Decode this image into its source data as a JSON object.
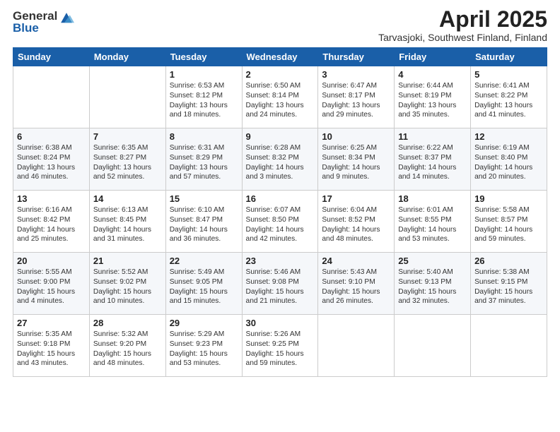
{
  "header": {
    "logo_general": "General",
    "logo_blue": "Blue",
    "month_title": "April 2025",
    "location": "Tarvasjoki, Southwest Finland, Finland"
  },
  "weekdays": [
    "Sunday",
    "Monday",
    "Tuesday",
    "Wednesday",
    "Thursday",
    "Friday",
    "Saturday"
  ],
  "weeks": [
    [
      {
        "day": "",
        "info": ""
      },
      {
        "day": "",
        "info": ""
      },
      {
        "day": "1",
        "info": "Sunrise: 6:53 AM\nSunset: 8:12 PM\nDaylight: 13 hours and 18 minutes."
      },
      {
        "day": "2",
        "info": "Sunrise: 6:50 AM\nSunset: 8:14 PM\nDaylight: 13 hours and 24 minutes."
      },
      {
        "day": "3",
        "info": "Sunrise: 6:47 AM\nSunset: 8:17 PM\nDaylight: 13 hours and 29 minutes."
      },
      {
        "day": "4",
        "info": "Sunrise: 6:44 AM\nSunset: 8:19 PM\nDaylight: 13 hours and 35 minutes."
      },
      {
        "day": "5",
        "info": "Sunrise: 6:41 AM\nSunset: 8:22 PM\nDaylight: 13 hours and 41 minutes."
      }
    ],
    [
      {
        "day": "6",
        "info": "Sunrise: 6:38 AM\nSunset: 8:24 PM\nDaylight: 13 hours and 46 minutes."
      },
      {
        "day": "7",
        "info": "Sunrise: 6:35 AM\nSunset: 8:27 PM\nDaylight: 13 hours and 52 minutes."
      },
      {
        "day": "8",
        "info": "Sunrise: 6:31 AM\nSunset: 8:29 PM\nDaylight: 13 hours and 57 minutes."
      },
      {
        "day": "9",
        "info": "Sunrise: 6:28 AM\nSunset: 8:32 PM\nDaylight: 14 hours and 3 minutes."
      },
      {
        "day": "10",
        "info": "Sunrise: 6:25 AM\nSunset: 8:34 PM\nDaylight: 14 hours and 9 minutes."
      },
      {
        "day": "11",
        "info": "Sunrise: 6:22 AM\nSunset: 8:37 PM\nDaylight: 14 hours and 14 minutes."
      },
      {
        "day": "12",
        "info": "Sunrise: 6:19 AM\nSunset: 8:40 PM\nDaylight: 14 hours and 20 minutes."
      }
    ],
    [
      {
        "day": "13",
        "info": "Sunrise: 6:16 AM\nSunset: 8:42 PM\nDaylight: 14 hours and 25 minutes."
      },
      {
        "day": "14",
        "info": "Sunrise: 6:13 AM\nSunset: 8:45 PM\nDaylight: 14 hours and 31 minutes."
      },
      {
        "day": "15",
        "info": "Sunrise: 6:10 AM\nSunset: 8:47 PM\nDaylight: 14 hours and 36 minutes."
      },
      {
        "day": "16",
        "info": "Sunrise: 6:07 AM\nSunset: 8:50 PM\nDaylight: 14 hours and 42 minutes."
      },
      {
        "day": "17",
        "info": "Sunrise: 6:04 AM\nSunset: 8:52 PM\nDaylight: 14 hours and 48 minutes."
      },
      {
        "day": "18",
        "info": "Sunrise: 6:01 AM\nSunset: 8:55 PM\nDaylight: 14 hours and 53 minutes."
      },
      {
        "day": "19",
        "info": "Sunrise: 5:58 AM\nSunset: 8:57 PM\nDaylight: 14 hours and 59 minutes."
      }
    ],
    [
      {
        "day": "20",
        "info": "Sunrise: 5:55 AM\nSunset: 9:00 PM\nDaylight: 15 hours and 4 minutes."
      },
      {
        "day": "21",
        "info": "Sunrise: 5:52 AM\nSunset: 9:02 PM\nDaylight: 15 hours and 10 minutes."
      },
      {
        "day": "22",
        "info": "Sunrise: 5:49 AM\nSunset: 9:05 PM\nDaylight: 15 hours and 15 minutes."
      },
      {
        "day": "23",
        "info": "Sunrise: 5:46 AM\nSunset: 9:08 PM\nDaylight: 15 hours and 21 minutes."
      },
      {
        "day": "24",
        "info": "Sunrise: 5:43 AM\nSunset: 9:10 PM\nDaylight: 15 hours and 26 minutes."
      },
      {
        "day": "25",
        "info": "Sunrise: 5:40 AM\nSunset: 9:13 PM\nDaylight: 15 hours and 32 minutes."
      },
      {
        "day": "26",
        "info": "Sunrise: 5:38 AM\nSunset: 9:15 PM\nDaylight: 15 hours and 37 minutes."
      }
    ],
    [
      {
        "day": "27",
        "info": "Sunrise: 5:35 AM\nSunset: 9:18 PM\nDaylight: 15 hours and 43 minutes."
      },
      {
        "day": "28",
        "info": "Sunrise: 5:32 AM\nSunset: 9:20 PM\nDaylight: 15 hours and 48 minutes."
      },
      {
        "day": "29",
        "info": "Sunrise: 5:29 AM\nSunset: 9:23 PM\nDaylight: 15 hours and 53 minutes."
      },
      {
        "day": "30",
        "info": "Sunrise: 5:26 AM\nSunset: 9:25 PM\nDaylight: 15 hours and 59 minutes."
      },
      {
        "day": "",
        "info": ""
      },
      {
        "day": "",
        "info": ""
      },
      {
        "day": "",
        "info": ""
      }
    ]
  ]
}
